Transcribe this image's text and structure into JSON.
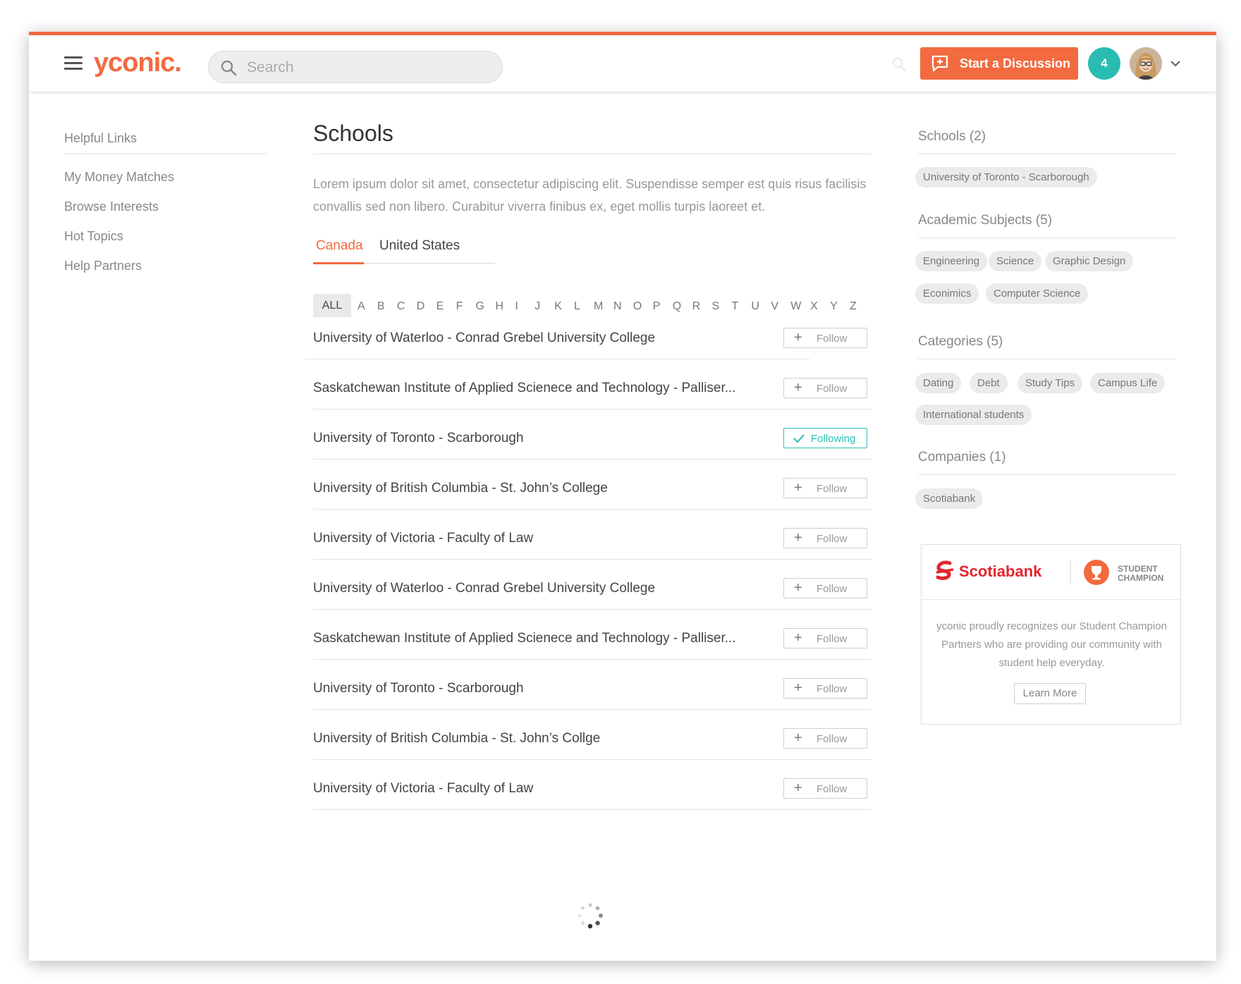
{
  "header": {
    "logo": "yconic.",
    "search_placeholder": "Search",
    "start_discussion": "Start a Discussion",
    "notification_count": "4"
  },
  "sidebar": {
    "title": "Helpful Links",
    "items": [
      {
        "label": "My Money Matches"
      },
      {
        "label": "Browse Interests"
      },
      {
        "label": "Hot Topics"
      },
      {
        "label": "Help Partners"
      }
    ]
  },
  "main": {
    "title": "Schools",
    "description": "Lorem ipsum dolor sit amet, consectetur adipiscing elit. Suspendisse semper est quis risus facilisis convallis sed non libero. Curabitur viverra finibus ex, eget mollis turpis laoreet et.",
    "tabs": [
      {
        "label": "Canada",
        "active": true
      },
      {
        "label": "United States",
        "active": false
      }
    ],
    "alphabet_all": "ALL",
    "alphabet": [
      "A",
      "B",
      "C",
      "D",
      "E",
      "F",
      "G",
      "H",
      "I",
      "J",
      "K",
      "L",
      "M",
      "N",
      "O",
      "P",
      "Q",
      "R",
      "S",
      "T",
      "U",
      "V",
      "W",
      "X",
      "Y",
      "Z"
    ],
    "schools": [
      {
        "name": "University of Waterloo - Conrad Grebel University College",
        "button": "Follow",
        "following": false
      },
      {
        "name": "Saskatchewan Institute of Applied Scienece and Technology - Palliser...",
        "button": "Follow",
        "following": false
      },
      {
        "name": "University of Toronto - Scarborough",
        "button": "Following",
        "following": true
      },
      {
        "name": "University of British Columbia - St. John’s College",
        "button": "Follow",
        "following": false
      },
      {
        "name": "University of Victoria - Faculty of Law",
        "button": "Follow",
        "following": false
      },
      {
        "name": "University of Waterloo - Conrad Grebel University College",
        "button": "Follow",
        "following": false
      },
      {
        "name": "Saskatchewan Institute of Applied Scienece and Technology - Palliser...",
        "button": "Follow",
        "following": false
      },
      {
        "name": "University of Toronto - Scarborough",
        "button": "Follow",
        "following": false
      },
      {
        "name": "University of British Columbia - St. John’s Collge",
        "button": "Follow",
        "following": false
      },
      {
        "name": "University of Victoria - Faculty of Law",
        "button": "Follow",
        "following": false
      }
    ]
  },
  "right": {
    "schools_heading": "Schools (2)",
    "schools_tags": [
      "University of Toronto - Scarborough"
    ],
    "subjects_heading": "Academic Subjects (5)",
    "subjects_tags": [
      "Engineering",
      "Science",
      "Graphic Design",
      "Econimics",
      "Computer Science"
    ],
    "categories_heading": "Categories (5)",
    "categories_tags": [
      "Dating",
      "Debt",
      "Study Tips",
      "Campus Life",
      "International students"
    ],
    "companies_heading": "Companies (1)",
    "companies_tags": [
      "Scotiabank"
    ],
    "promo": {
      "brand": "Scotiabank",
      "badge_line1": "STUDENT",
      "badge_line2": "CHAMPION",
      "text": "yconic proudly recognizes our Student Champion Partners who are providing our community with student help everyday.",
      "button": "Learn More"
    }
  },
  "colors": {
    "accent": "#f26a3f",
    "teal": "#2bbcb1",
    "scotiabank_red": "#e3262e"
  },
  "icons": [
    "menu-icon",
    "search-icon",
    "add-comment-icon",
    "chevron-down-icon",
    "plus-icon",
    "check-icon",
    "trophy-icon",
    "scotiabank-logo-icon",
    "spinner-icon"
  ]
}
